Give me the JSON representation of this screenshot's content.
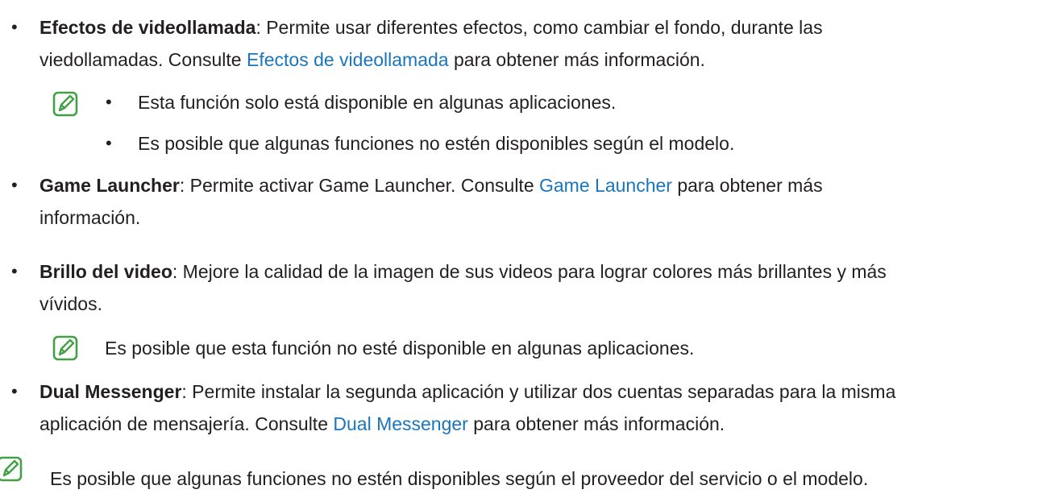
{
  "accent_color": "#43a047",
  "link_color": "#1b75bc",
  "bullet_glyph": "•",
  "items": [
    {
      "title": "Efectos de videollamada",
      "desc_line1": ": Permite usar diferentes efectos, como cambiar el fondo, durante las",
      "desc_line2_pre": "viedollamadas. Consulte ",
      "link": "Efectos de videollamada",
      "desc_line2_post": " para obtener más información."
    },
    {
      "title": "Game Launcher",
      "desc_line1_pre": ": Permite activar Game Launcher. Consulte ",
      "link": "Game Launcher",
      "desc_line1_post": " para obtener más",
      "desc_line2": "información."
    },
    {
      "title": "Brillo del video",
      "desc_line1": ": Mejore la calidad de la imagen de sus videos para lograr colores más brillantes y más",
      "desc_line2": "vívidos."
    },
    {
      "title": "Dual Messenger",
      "desc_line1": ": Permite instalar la segunda aplicación y utilizar dos cuentas separadas para la misma",
      "desc_line2_pre": "aplicación de mensajería. Consulte ",
      "link": "Dual Messenger",
      "desc_line2_post": " para obtener más información."
    }
  ],
  "notes": {
    "video_effects": [
      "Esta función solo está disponible en algunas aplicaciones.",
      "Es posible que algunas funciones no estén disponibles según el modelo."
    ],
    "video_brightness": "Es posible que esta función no esté disponible en algunas aplicaciones.",
    "footer": "Es posible que algunas funciones no estén disponibles según el proveedor del servicio o el modelo."
  },
  "icons": {
    "note": "note-pencil-icon"
  }
}
